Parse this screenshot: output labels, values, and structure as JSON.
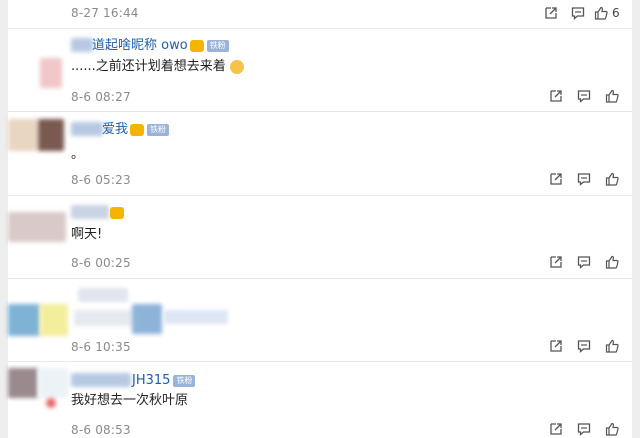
{
  "comments": [
    {
      "time": "8-27 16:44",
      "likes": "6"
    },
    {
      "name": "道起啥昵称 owo",
      "text": "......之前还计划着想去来着",
      "time": "8-6 08:27"
    },
    {
      "name": "爱我",
      "text": "。",
      "time": "8-6 05:23"
    },
    {
      "name": "",
      "text": "啊天!",
      "time": "8-6 00:25"
    },
    {
      "name": "",
      "text": "",
      "time": "8-6 10:35"
    },
    {
      "name": "JH315",
      "text": "我好想去一次秋叶原",
      "time": "8-6 08:53"
    }
  ],
  "badge_label": "铁粉",
  "colors": {
    "link": "#1f5fa8",
    "muted": "#8a8a8a",
    "crown": "#f4b400",
    "badge": "#9ab3d8"
  },
  "icons": [
    "share-icon",
    "comment-icon",
    "like-icon"
  ]
}
